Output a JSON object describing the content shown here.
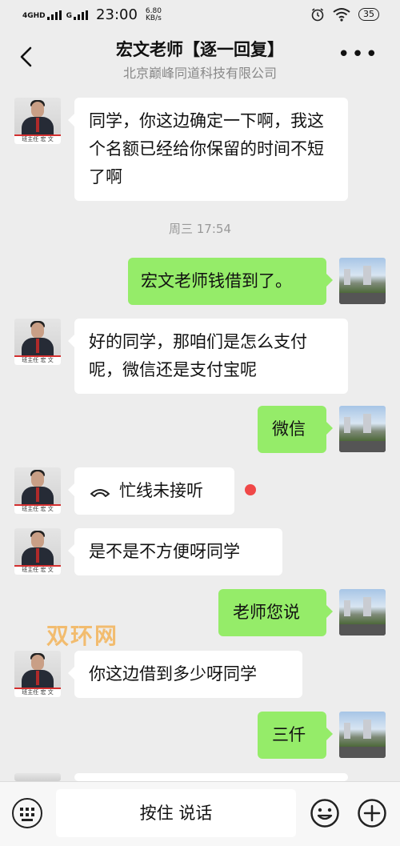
{
  "status_bar": {
    "network": "4GHD",
    "network2": "G",
    "time": "23:00",
    "speed_value": "6.80",
    "speed_unit": "KB/s",
    "battery": "35"
  },
  "header": {
    "title": "宏文老师【逐一回复】",
    "subtitle": "北京巅峰同道科技有限公司"
  },
  "contact": {
    "avatar_name": "宏 文",
    "avatar_role": "班主任"
  },
  "messages": [
    {
      "from": "contact",
      "text": "同学，你这边确定一下啊，我这个名额已经给你保留的时间不短了啊"
    },
    {
      "from": "timestamp",
      "text": "周三 17:54"
    },
    {
      "from": "me",
      "text": "宏文老师钱借到了。"
    },
    {
      "from": "contact",
      "text": "好的同学，那咱们是怎么支付呢，微信还是支付宝呢"
    },
    {
      "from": "me",
      "text": "微信"
    },
    {
      "from": "contact",
      "text": "忙线未接听",
      "type": "call"
    },
    {
      "from": "contact",
      "text": "是不是不方便呀同学"
    },
    {
      "from": "me",
      "text": "老师您说"
    },
    {
      "from": "contact",
      "text": "你这边借到多少呀同学"
    },
    {
      "from": "me",
      "text": "三仟"
    }
  ],
  "watermark": "双环网",
  "input_bar": {
    "hold_to_talk": "按住 说话"
  },
  "colors": {
    "outgoing_bubble": "#95ec69",
    "incoming_bubble": "#ffffff",
    "background": "#ededed",
    "unread_dot": "#f04848"
  },
  "icons": [
    "back-arrow-icon",
    "more-icon",
    "phone-icon",
    "keyboard-icon",
    "emoji-icon",
    "plus-icon"
  ]
}
